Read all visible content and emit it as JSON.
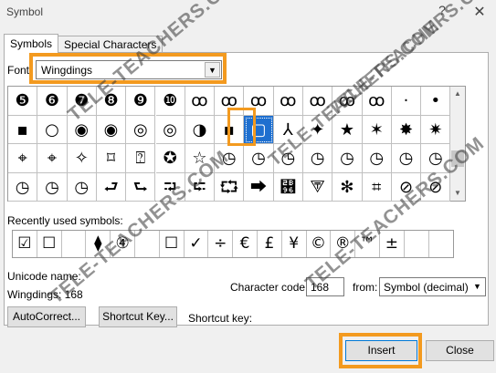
{
  "window": {
    "title": "Symbol",
    "help": "?",
    "close": "✕"
  },
  "tabs": [
    {
      "label": "Symbols",
      "active": true
    },
    {
      "label": "Special Characters",
      "active": false
    }
  ],
  "font": {
    "label": "Font:",
    "value": "Wingdings"
  },
  "grid": {
    "rows": [
      [
        "❺",
        "❻",
        "❼",
        "❽",
        "❾",
        "❿",
        "ꝏ",
        "ꝏ",
        "ꝏ",
        "ꝏ",
        "ꝏ",
        "ꝏ",
        "ꝏ",
        "·",
        "•"
      ],
      [
        "▪",
        "○",
        "◉",
        "◉",
        "◎",
        "◎",
        "◑",
        "▪",
        "▢",
        "⅄",
        "✦",
        "★",
        "✶",
        "✸",
        "✷"
      ],
      [
        "⌖",
        "⌖",
        "✧",
        "⌑",
        "⍰",
        "✪",
        "☆",
        "◷",
        "◷",
        "◷",
        "◷",
        "◷",
        "◷",
        "◷",
        "◷"
      ],
      [
        "◷",
        "◷",
        "◷",
        "⮐",
        "⮑",
        "⮒",
        "⮓",
        "⮔",
        "⮕",
        "⮖",
        "⮗",
        "✻",
        "⌗",
        "⊘",
        "⊘"
      ]
    ],
    "selected": {
      "row": 1,
      "col": 8
    }
  },
  "recent": {
    "label": "Recently used symbols:",
    "items": [
      "☑",
      "☐",
      "",
      "⧫",
      "④",
      "",
      "☐",
      "✓",
      "÷",
      "€",
      "£",
      "¥",
      "©",
      "®",
      "™",
      "±",
      ""
    ]
  },
  "unicode": {
    "label": "Unicode name:",
    "value": "Wingdings: 168"
  },
  "character_code": {
    "label": "Character code:",
    "value": "168"
  },
  "from": {
    "label": "from:",
    "value": "Symbol (decimal)"
  },
  "buttons": {
    "autocorrect": "AutoCorrect...",
    "shortcut_key": "Shortcut Key...",
    "insert": "Insert",
    "close": "Close"
  },
  "shortcut_label": "Shortcut key:",
  "watermark": "TELE-TEACHERS.COM",
  "colors": {
    "highlight": "#f39a1f",
    "selection": "#1e6fcf"
  }
}
